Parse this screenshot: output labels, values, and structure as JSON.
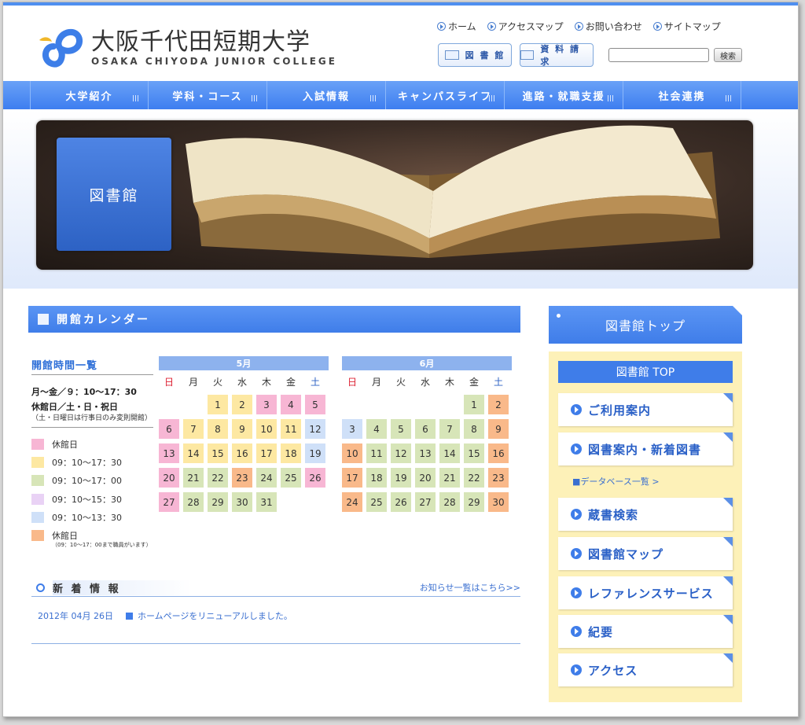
{
  "header": {
    "logo_jp": "大阪千代田短期大学",
    "logo_en": "OSAKA CHIYODA JUNIOR COLLEGE",
    "util_links": [
      "ホーム",
      "アクセスマップ",
      "お問い合わせ",
      "サイトマップ"
    ],
    "library_btn": "図 書 館",
    "request_btn": "資 料 請 求",
    "search_placeholder": "",
    "search_btn": "検索"
  },
  "nav": [
    "大学紹介",
    "学科・コース",
    "入試情報",
    "キャンパスライフ",
    "進路・就職支援",
    "社会連携"
  ],
  "hero": {
    "label": "図書館"
  },
  "calendar": {
    "heading": "開館カレンダー",
    "hours_title": "開館時間一覧",
    "hours_weekday": "月〜金／９：10〜17：30",
    "hours_closed": "休館日／土・日・祝日",
    "hours_note": "（土・日曜日は行事日のみ変則開館）",
    "legend": [
      {
        "label": "休館日",
        "color": "#f7b6d4"
      },
      {
        "label": "09：10〜17：30",
        "color": "#fde8a2"
      },
      {
        "label": "09：10〜17：00",
        "color": "#d7e5b8"
      },
      {
        "label": "09：10〜15：30",
        "color": "#e9d2f5"
      },
      {
        "label": "09：10〜13：30",
        "color": "#cfe0f8"
      },
      {
        "label": "休館日",
        "color": "#f9b98a",
        "sub": "（09：10〜17：00まで職員がいます）"
      }
    ],
    "weekdays": [
      "日",
      "月",
      "火",
      "水",
      "木",
      "金",
      "土"
    ],
    "months": [
      {
        "name": "5月",
        "offset": 2,
        "days": [
          {
            "d": "1",
            "c": "yel"
          },
          {
            "d": "2",
            "c": "yel"
          },
          {
            "d": "3",
            "c": "pink"
          },
          {
            "d": "4",
            "c": "pink"
          },
          {
            "d": "5",
            "c": "pink"
          },
          {
            "d": "6",
            "c": "pink"
          },
          {
            "d": "7",
            "c": "yel"
          },
          {
            "d": "8",
            "c": "yel"
          },
          {
            "d": "9",
            "c": "yel"
          },
          {
            "d": "10",
            "c": "yel"
          },
          {
            "d": "11",
            "c": "yel"
          },
          {
            "d": "12",
            "c": "blue"
          },
          {
            "d": "13",
            "c": "pink"
          },
          {
            "d": "14",
            "c": "yel"
          },
          {
            "d": "15",
            "c": "yel"
          },
          {
            "d": "16",
            "c": "yel"
          },
          {
            "d": "17",
            "c": "yel"
          },
          {
            "d": "18",
            "c": "yel"
          },
          {
            "d": "19",
            "c": "blue"
          },
          {
            "d": "20",
            "c": "pink"
          },
          {
            "d": "21",
            "c": "grn"
          },
          {
            "d": "22",
            "c": "grn"
          },
          {
            "d": "23",
            "c": "org"
          },
          {
            "d": "24",
            "c": "grn"
          },
          {
            "d": "25",
            "c": "grn"
          },
          {
            "d": "26",
            "c": "pink"
          },
          {
            "d": "27",
            "c": "pink"
          },
          {
            "d": "28",
            "c": "grn"
          },
          {
            "d": "29",
            "c": "grn"
          },
          {
            "d": "30",
            "c": "grn"
          },
          {
            "d": "31",
            "c": "grn"
          }
        ]
      },
      {
        "name": "6月",
        "offset": 5,
        "days": [
          {
            "d": "1",
            "c": "grn"
          },
          {
            "d": "2",
            "c": "org"
          },
          {
            "d": "3",
            "c": "blue"
          },
          {
            "d": "4",
            "c": "grn"
          },
          {
            "d": "5",
            "c": "grn"
          },
          {
            "d": "6",
            "c": "grn"
          },
          {
            "d": "7",
            "c": "grn"
          },
          {
            "d": "8",
            "c": "grn"
          },
          {
            "d": "9",
            "c": "org"
          },
          {
            "d": "10",
            "c": "org"
          },
          {
            "d": "11",
            "c": "grn"
          },
          {
            "d": "12",
            "c": "grn"
          },
          {
            "d": "13",
            "c": "grn"
          },
          {
            "d": "14",
            "c": "grn"
          },
          {
            "d": "15",
            "c": "grn"
          },
          {
            "d": "16",
            "c": "org"
          },
          {
            "d": "17",
            "c": "org"
          },
          {
            "d": "18",
            "c": "grn"
          },
          {
            "d": "19",
            "c": "grn"
          },
          {
            "d": "20",
            "c": "grn"
          },
          {
            "d": "21",
            "c": "grn"
          },
          {
            "d": "22",
            "c": "grn"
          },
          {
            "d": "23",
            "c": "org"
          },
          {
            "d": "24",
            "c": "org"
          },
          {
            "d": "25",
            "c": "grn"
          },
          {
            "d": "26",
            "c": "grn"
          },
          {
            "d": "27",
            "c": "grn"
          },
          {
            "d": "28",
            "c": "grn"
          },
          {
            "d": "29",
            "c": "grn"
          },
          {
            "d": "30",
            "c": "org"
          }
        ]
      }
    ]
  },
  "news": {
    "title": "新 着 情 報",
    "more": "お知らせ一覧はこちら>>",
    "items": [
      {
        "date": "2012年 04月 26日",
        "text": "ホームページをリニューアルしました。"
      }
    ]
  },
  "sidebar": {
    "top": "図書館トップ",
    "sub": "図書館 TOP",
    "items": [
      "ご利用案内",
      "図書案内・新着図書",
      "蔵書検索",
      "図書館マップ",
      "レファレンスサービス",
      "紀要",
      "アクセス"
    ],
    "db_link": "■データベース一覧 >"
  }
}
